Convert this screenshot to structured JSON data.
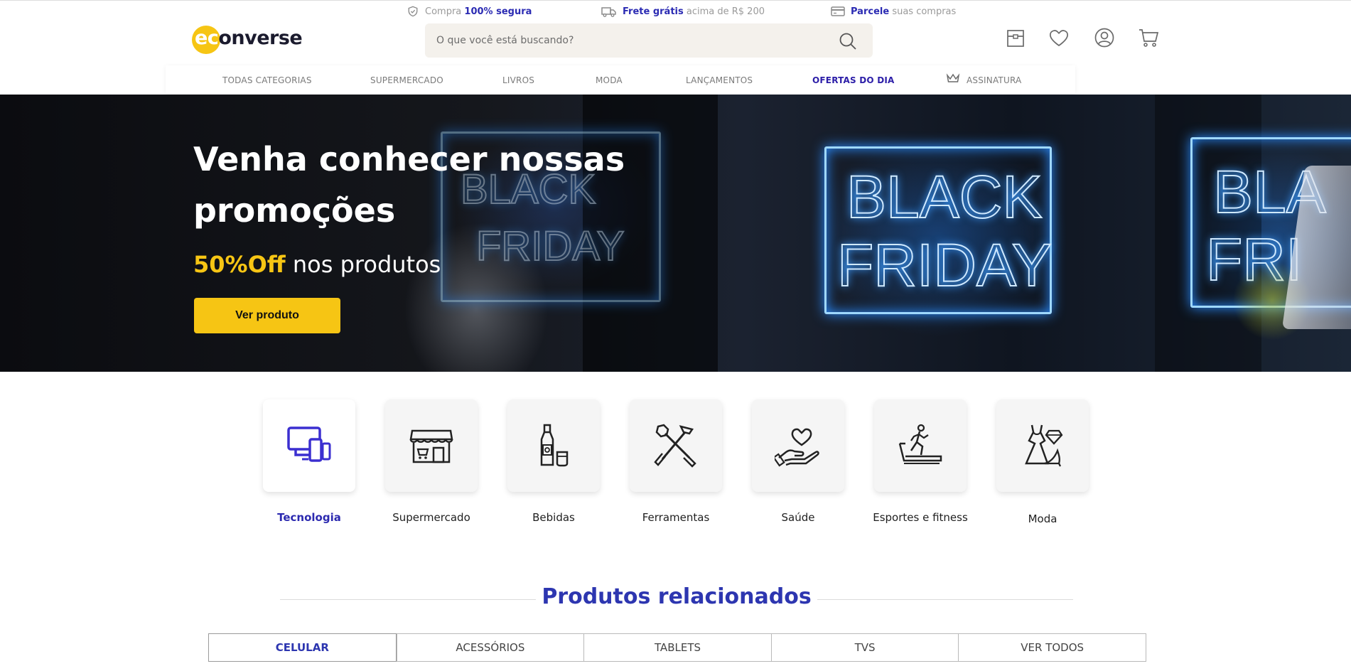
{
  "topbar": {
    "secure": {
      "prefix": "Compra",
      "bold": "100% segura",
      "icon": "shield-check-icon"
    },
    "shipping": {
      "bold": "Frete grátis",
      "suffix": "acima de R$ 200",
      "icon": "truck-icon"
    },
    "installments": {
      "bold": "Parcele",
      "suffix": "suas compras",
      "icon": "credit-card-icon"
    }
  },
  "header": {
    "logo_ec": "ec",
    "logo_rest": "onverse",
    "search_placeholder": "O que você está buscando?",
    "icons": [
      "store-icon",
      "heart-icon",
      "user-icon",
      "cart-icon"
    ]
  },
  "nav": {
    "items": [
      "TODAS CATEGORIAS",
      "SUPERMERCADO",
      "LIVROS",
      "MODA",
      "LANÇAMENTOS",
      "OFERTAS DO DIA",
      "ASSINATURA"
    ]
  },
  "hero": {
    "title": "Venha conhecer nossas promoções",
    "off": "50%Off",
    "sub_rest": " nos produtos",
    "cta": "Ver produto"
  },
  "categories": [
    {
      "label": "Tecnologia",
      "icon": "devices-icon",
      "active": true
    },
    {
      "label": "Supermercado",
      "icon": "storefront-icon"
    },
    {
      "label": "Bebidas",
      "icon": "bottle-icon"
    },
    {
      "label": "Ferramentas",
      "icon": "tools-icon"
    },
    {
      "label": "Saúde",
      "icon": "heart-hand-icon"
    },
    {
      "label": "Esportes e fitness",
      "icon": "treadmill-icon"
    },
    {
      "label": "Moda",
      "icon": "dress-icon"
    }
  ],
  "related": {
    "title": "Produtos relacionados",
    "tabs": [
      "CELULAR",
      "ACESSÓRIOS",
      "TABLETS",
      "TVS",
      "VER TODOS"
    ],
    "active_tab": "CELULAR"
  },
  "colors": {
    "accent": "#f6c514",
    "brand_blue": "#2d36b0",
    "nav_highlight": "#2c1ea8"
  }
}
